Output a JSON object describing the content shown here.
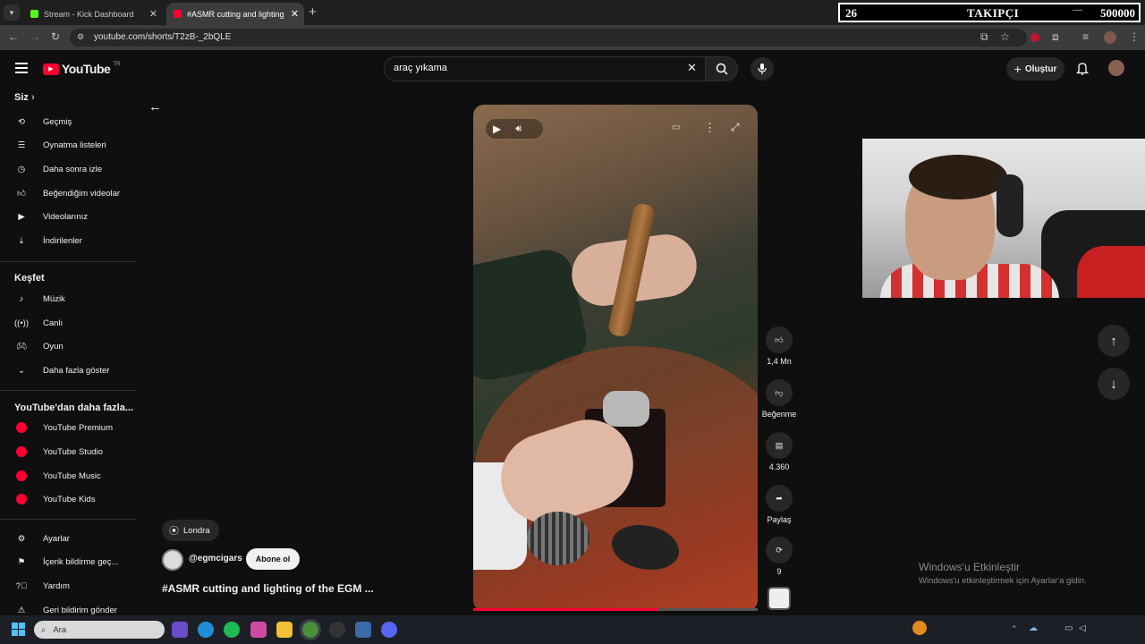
{
  "browser": {
    "tabs": [
      {
        "title": "Stream - Kick Dashboard"
      },
      {
        "title": "#ASMR cutting and lighting of"
      }
    ],
    "url": "youtube.com/shorts/T2zB-_2bQLE"
  },
  "overlay": {
    "count_left": "26",
    "label": "TAKIPÇI",
    "count_right": "500000"
  },
  "header": {
    "logo": "YouTube",
    "region": "TR",
    "search_value": "araç yıkama",
    "create_label": "Oluştur"
  },
  "sidebar": {
    "you_heading": "Siz",
    "you_items": [
      {
        "label": "Geçmiş",
        "icon": "history-icon"
      },
      {
        "label": "Oynatma listeleri",
        "icon": "playlist-icon"
      },
      {
        "label": "Daha sonra izle",
        "icon": "clock-icon"
      },
      {
        "label": "Beğendiğim videolar",
        "icon": "thumbs-up-icon"
      },
      {
        "label": "Videolarınız",
        "icon": "video-icon"
      },
      {
        "label": "İndirilenler",
        "icon": "download-icon"
      }
    ],
    "explore_heading": "Keşfet",
    "explore_items": [
      {
        "label": "Müzik",
        "icon": "music-icon"
      },
      {
        "label": "Canlı",
        "icon": "live-icon"
      },
      {
        "label": "Oyun",
        "icon": "gaming-icon"
      },
      {
        "label": "Daha fazla göster",
        "icon": "chevron-down-icon"
      }
    ],
    "more_heading": "YouTube'dan daha fazla...",
    "more_items": [
      {
        "label": "YouTube Premium"
      },
      {
        "label": "YouTube Studio"
      },
      {
        "label": "YouTube Music"
      },
      {
        "label": "YouTube Kids"
      }
    ],
    "settings_items": [
      {
        "label": "Ayarlar",
        "icon": "gear-icon"
      },
      {
        "label": "İçerik bildirme geç...",
        "icon": "flag-icon"
      },
      {
        "label": "Yardım",
        "icon": "help-icon"
      },
      {
        "label": "Geri bildirim gönder",
        "icon": "feedback-icon"
      }
    ]
  },
  "short": {
    "location": "Londra",
    "channel": "@egmcigars",
    "subscribe_label": "Abone ol",
    "title": "#ASMR cutting and lighting of the EGM ...",
    "progress": 0.65,
    "actions": {
      "likes": "1,4 Mn",
      "dislike_label": "Beğenme",
      "comments": "4.360",
      "share_label": "Paylaş",
      "remix_count": "9"
    }
  },
  "windows": {
    "activation_title": "Windows'u Etkinleştir",
    "activation_text": "Windows'u etkinleştirmek için Ayarlar'a gidin.",
    "taskbar_search": "Ara"
  },
  "colors": {
    "accent": "#ff0033",
    "background": "#0f0f0f"
  }
}
